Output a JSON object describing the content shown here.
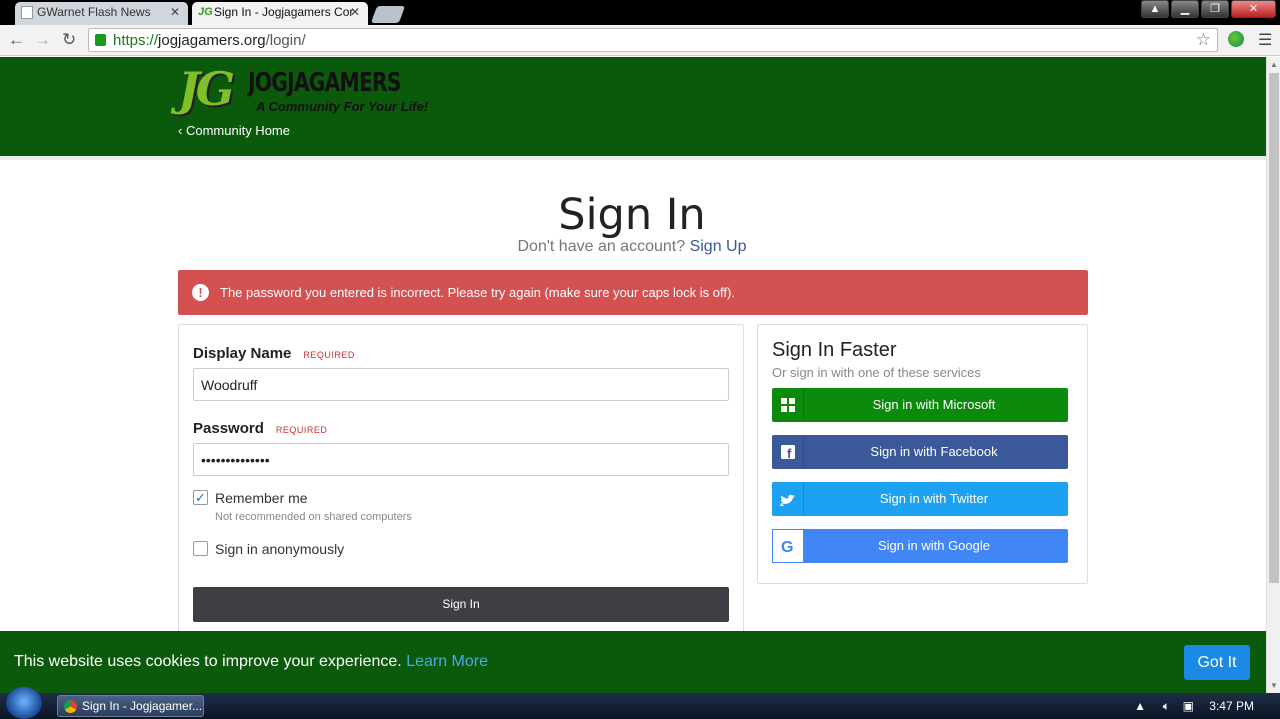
{
  "browser": {
    "tabs": [
      {
        "label": "GWarnet Flash News",
        "active": false
      },
      {
        "label": "Sign In - Jogjagamers Cor",
        "active": true
      }
    ],
    "url_scheme": "https://",
    "url_host": "jogjagamers.org",
    "url_path": "/login/"
  },
  "header": {
    "logo_initials": "JG",
    "logo_name": "JOGJAGAMERS",
    "logo_tagline": "A Community For Your Life!",
    "community_home": "Community Home"
  },
  "main": {
    "title": "Sign In",
    "no_account": "Don't have an account?",
    "signup_link": "Sign Up"
  },
  "alert": {
    "icon": "exclamation-icon",
    "message": "The password you entered is incorrect. Please try again (make sure your caps lock is off)."
  },
  "form": {
    "display_name_label": "Display Name",
    "display_name_required": "REQUIRED",
    "display_name_value": "Woodruff",
    "password_label": "Password",
    "password_required": "REQUIRED",
    "password_value": "••••••••••••••",
    "remember_label": "Remember me",
    "remember_checked": true,
    "remember_hint": "Not recommended on shared computers",
    "anon_label": "Sign in anonymously",
    "anon_checked": false,
    "submit_label": "Sign In"
  },
  "sso": {
    "title": "Sign In Faster",
    "subtitle": "Or sign in with one of these services",
    "microsoft": "Sign in with Microsoft",
    "facebook": "Sign in with Facebook",
    "twitter": "Sign in with Twitter",
    "google": "Sign in with Google",
    "colors": {
      "microsoft": "#0b8a0b",
      "facebook": "#3b5998",
      "twitter": "#1da1f2",
      "google": "#4285f4"
    }
  },
  "cookie": {
    "text": "This website uses cookies to improve your experience.",
    "learn_more": "Learn More",
    "button": "Got It"
  },
  "taskbar": {
    "task_label": "Sign In - Jogjagamer...",
    "clock": "3:47 PM"
  },
  "colors": {
    "header_green": "#0b5a0b",
    "alert_red": "#d35150",
    "accent_blue": "#1a8ae6"
  }
}
